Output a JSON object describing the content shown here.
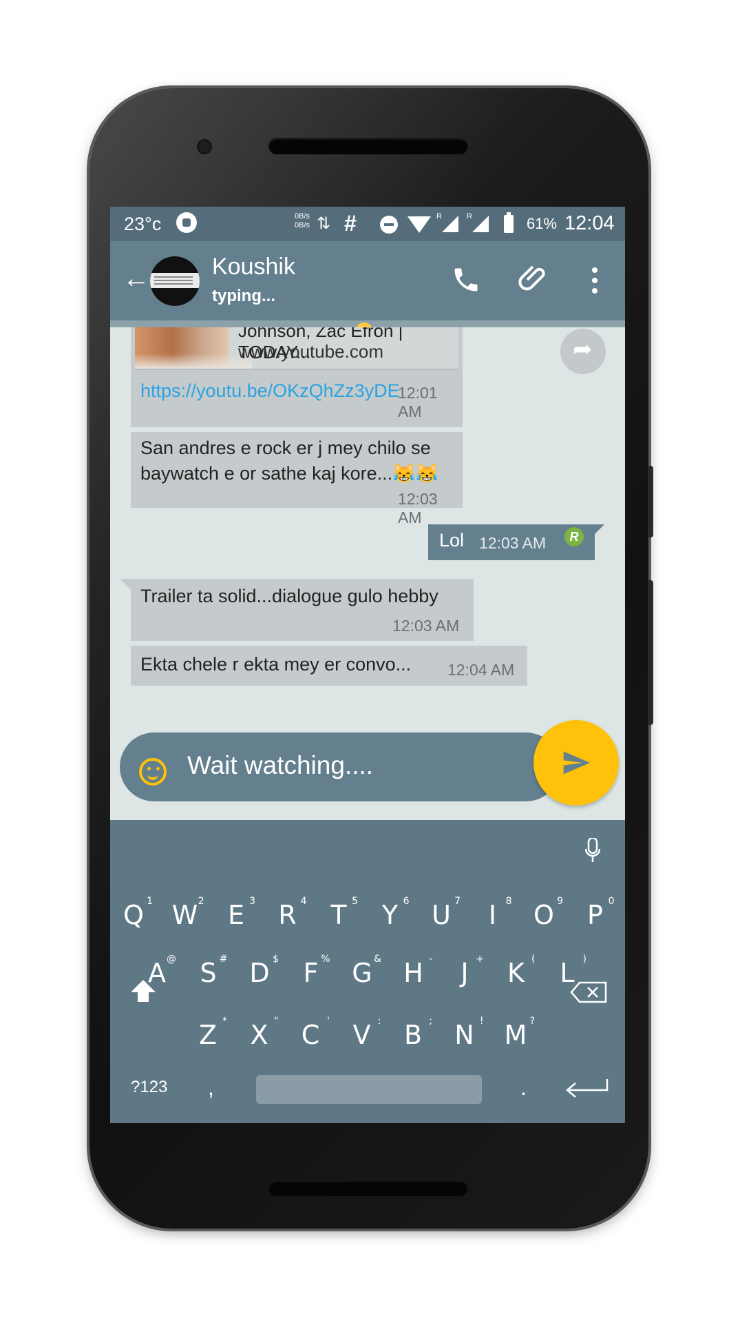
{
  "status_bar": {
    "temperature": "23°c",
    "net_speed_up": "0B/s",
    "net_speed_down": "0B/s",
    "hash": "#",
    "battery_percent": "61%",
    "clock": "12:04",
    "roaming_label": "R"
  },
  "app_bar": {
    "contact_name": "Koushik",
    "status": "typing..."
  },
  "messages": {
    "link_preview_title": "Johnson, Zac Efron | TODAY...",
    "link_preview_domain": "www.youtube.com",
    "link_url": "https://youtu.be/OKzQhZz3yDE",
    "link_time": "12:01 AM",
    "msg2_line1": "San andres e rock er j mey chilo se",
    "msg2_line2": "baywatch e or sathe kaj kore...😹😹",
    "msg2_time": "12:03 AM",
    "out_msg": "Lol",
    "out_time": "12:03 AM",
    "read_badge": "R",
    "msg3": "Trailer ta solid...dialogue gulo hebby",
    "msg3_time": "12:03 AM",
    "msg4": "Ekta chele r ekta mey er convo...",
    "msg4_time": "12:04 AM"
  },
  "composer": {
    "text": "Wait watching...."
  },
  "keyboard": {
    "row1": [
      {
        "k": "Q",
        "s": "1"
      },
      {
        "k": "W",
        "s": "2"
      },
      {
        "k": "E",
        "s": "3"
      },
      {
        "k": "R",
        "s": "4"
      },
      {
        "k": "T",
        "s": "5"
      },
      {
        "k": "Y",
        "s": "6"
      },
      {
        "k": "U",
        "s": "7"
      },
      {
        "k": "I",
        "s": "8"
      },
      {
        "k": "O",
        "s": "9"
      },
      {
        "k": "P",
        "s": "0"
      }
    ],
    "row2": [
      {
        "k": "A",
        "s": "@"
      },
      {
        "k": "S",
        "s": "#"
      },
      {
        "k": "D",
        "s": "$"
      },
      {
        "k": "F",
        "s": "%"
      },
      {
        "k": "G",
        "s": "&"
      },
      {
        "k": "H",
        "s": "-"
      },
      {
        "k": "J",
        "s": "+"
      },
      {
        "k": "K",
        "s": "("
      },
      {
        "k": "L",
        "s": ")"
      }
    ],
    "row3": [
      {
        "k": "Z",
        "s": "*"
      },
      {
        "k": "X",
        "s": "\""
      },
      {
        "k": "C",
        "s": "'"
      },
      {
        "k": "V",
        "s": ":"
      },
      {
        "k": "B",
        "s": ";"
      },
      {
        "k": "N",
        "s": "!"
      },
      {
        "k": "M",
        "s": "?"
      }
    ],
    "symbols_key": "?123",
    "comma_key": ",",
    "period_key": "."
  },
  "colors": {
    "header": "#64808e",
    "accent": "#ffc10a",
    "chat_bg": "#dde6e4"
  }
}
